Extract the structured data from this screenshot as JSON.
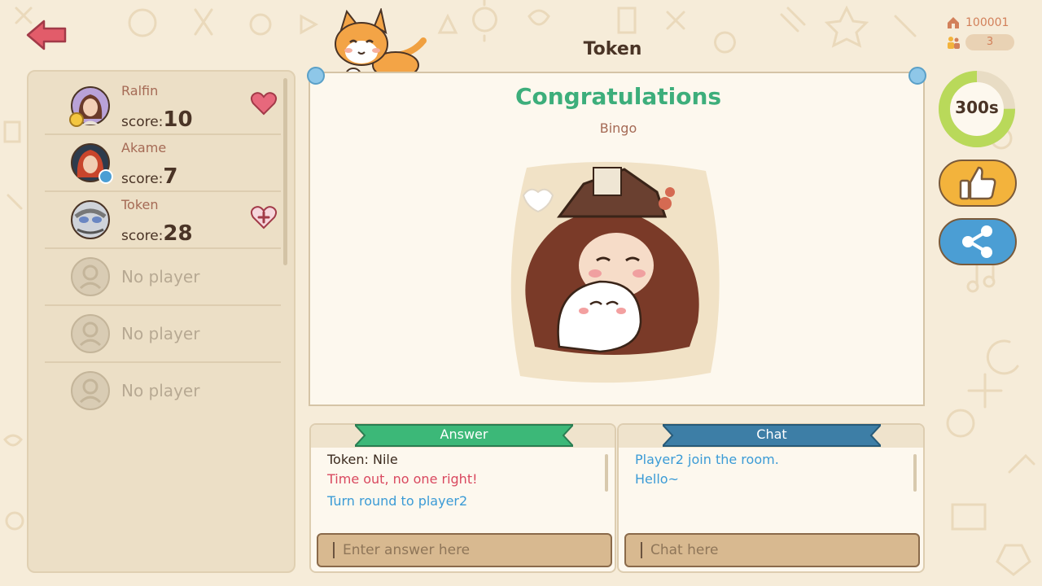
{
  "header": {
    "room_title": "Token",
    "home_count": "100001",
    "player_count": "3"
  },
  "timer": {
    "label": "300s",
    "remaining_fraction": 0.75
  },
  "players": [
    {
      "name": "Ralfin",
      "score_label": "score:",
      "score": "10",
      "badge": "crown-icon",
      "action": "heart-icon"
    },
    {
      "name": "Akame",
      "score_label": "score:",
      "score": "7",
      "badge": "camera-icon",
      "action": ""
    },
    {
      "name": "Token",
      "score_label": "score:",
      "score": "28",
      "badge": "",
      "action": "heart-plus-icon"
    },
    {
      "empty_label": "No player"
    },
    {
      "empty_label": "No player"
    },
    {
      "empty_label": "No player"
    }
  ],
  "result": {
    "title": "Congratulations",
    "subtitle": "Bingo"
  },
  "answer_panel": {
    "title": "Answer",
    "messages": [
      {
        "text": "Token: Nile",
        "color": "dark"
      },
      {
        "text": "Time out, no one right!",
        "color": "red"
      },
      {
        "text": "Turn round to player2",
        "color": "blue"
      }
    ],
    "placeholder": "Enter answer here"
  },
  "chat_panel": {
    "title": "Chat",
    "messages": [
      {
        "text": "Player2 join the room.",
        "color": "blue"
      },
      {
        "text": "Hello~",
        "color": "blue"
      }
    ],
    "placeholder": "Chat here"
  },
  "colors": {
    "background": "#f6ecd9",
    "accent_green": "#3dae7b",
    "answer_ribbon": "#3cb878",
    "chat_ribbon": "#3d7ea6",
    "like_button": "#f3b33c",
    "share_button": "#4b9ed4",
    "error_text": "#d9485f",
    "info_text": "#3b9bd6"
  }
}
